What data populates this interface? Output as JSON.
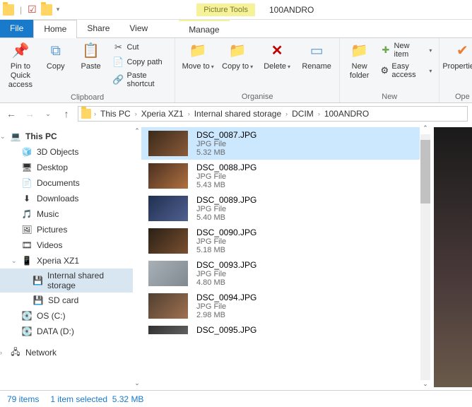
{
  "window": {
    "context_tab": "Picture Tools",
    "title": "100ANDRO"
  },
  "tabs": {
    "file": "File",
    "home": "Home",
    "share": "Share",
    "view": "View",
    "manage": "Manage"
  },
  "ribbon": {
    "clipboard": {
      "label": "Clipboard",
      "pin": "Pin to Quick access",
      "copy": "Copy",
      "paste": "Paste",
      "cut": "Cut",
      "copy_path": "Copy path",
      "paste_shortcut": "Paste shortcut"
    },
    "organise": {
      "label": "Organise",
      "move_to": "Move to",
      "copy_to": "Copy to",
      "delete": "Delete",
      "rename": "Rename"
    },
    "new": {
      "label": "New",
      "new_folder": "New folder",
      "new_item": "New item",
      "easy_access": "Easy access"
    },
    "open": {
      "label": "Ope",
      "properties": "Properties"
    }
  },
  "breadcrumb": [
    "This PC",
    "Xperia XZ1",
    "Internal shared storage",
    "DCIM",
    "100ANDRO"
  ],
  "tree": {
    "this_pc": "This PC",
    "items": [
      {
        "icon": "cube",
        "label": "3D Objects"
      },
      {
        "icon": "desktop",
        "label": "Desktop"
      },
      {
        "icon": "doc",
        "label": "Documents"
      },
      {
        "icon": "down",
        "label": "Downloads"
      },
      {
        "icon": "music",
        "label": "Music"
      },
      {
        "icon": "pic",
        "label": "Pictures"
      },
      {
        "icon": "vid",
        "label": "Videos"
      },
      {
        "icon": "phone",
        "label": "Xperia XZ1"
      },
      {
        "icon": "storage",
        "label": "Internal shared storage",
        "level": 3,
        "selected": true
      },
      {
        "icon": "sd",
        "label": "SD card",
        "level": 3
      },
      {
        "icon": "disk",
        "label": "OS (C:)"
      },
      {
        "icon": "disk",
        "label": "DATA (D:)"
      }
    ],
    "network": "Network"
  },
  "files": [
    {
      "name": "DSC_0087.JPG",
      "type": "JPG File",
      "size": "5.32 MB",
      "selected": true,
      "t": "t1"
    },
    {
      "name": "DSC_0088.JPG",
      "type": "JPG File",
      "size": "5.43 MB",
      "t": "t2"
    },
    {
      "name": "DSC_0089.JPG",
      "type": "JPG File",
      "size": "5.40 MB",
      "t": "t3"
    },
    {
      "name": "DSC_0090.JPG",
      "type": "JPG File",
      "size": "5.18 MB",
      "t": "t4"
    },
    {
      "name": "DSC_0093.JPG",
      "type": "JPG File",
      "size": "4.80 MB",
      "t": "t5"
    },
    {
      "name": "DSC_0094.JPG",
      "type": "JPG File",
      "size": "2.98 MB",
      "t": "t6"
    },
    {
      "name": "DSC_0095.JPG",
      "type": "",
      "size": "",
      "t": "t7"
    }
  ],
  "status": {
    "count": "79 items",
    "selection": "1 item selected",
    "size": "5.32 MB"
  }
}
